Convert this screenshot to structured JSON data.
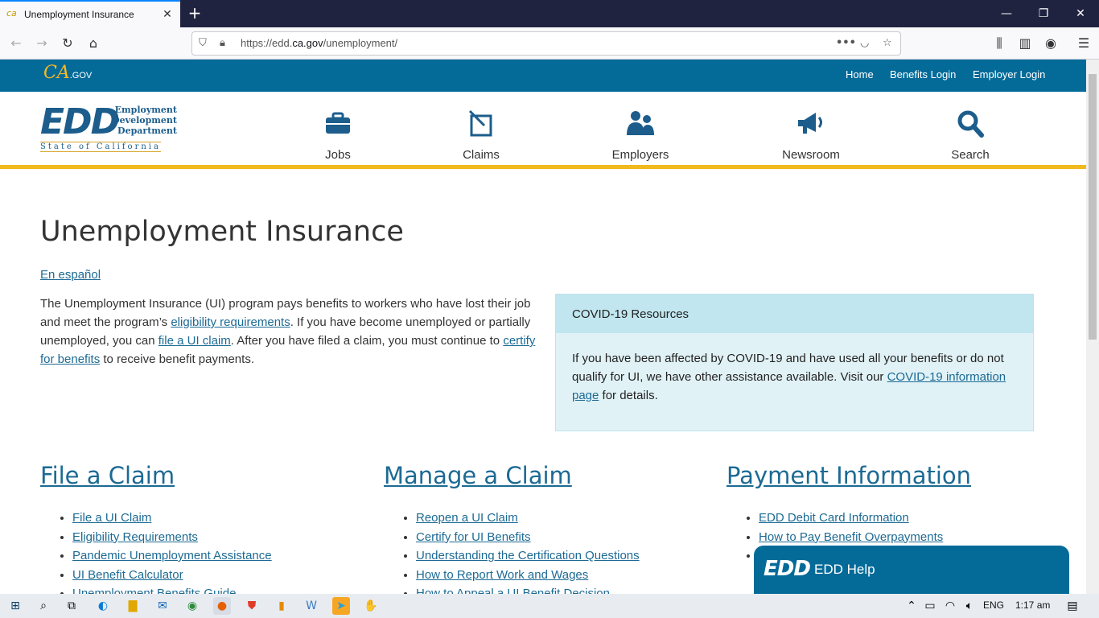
{
  "browser": {
    "tab_title": "Unemployment Insurance",
    "tab_close": "✕",
    "new_tab": "+",
    "url_prefix": "https://edd.",
    "url_domain": "ca.gov",
    "url_path": "/unemployment/",
    "min": "—",
    "restore": "❐",
    "close": "✕"
  },
  "ca_bar": {
    "logo_ca": "CA",
    "logo_gov": ".GOV",
    "links": [
      "Home",
      "Benefits Login",
      "Employer Login"
    ]
  },
  "edd_logo": {
    "mark": "EDD",
    "dept_line1": "Employment",
    "dept_line2": "Development",
    "dept_line3": "Department",
    "state": "State of California"
  },
  "main_nav": [
    "Jobs",
    "Claims",
    "Employers",
    "Newsroom",
    "Search"
  ],
  "page_title": "Unemployment Insurance",
  "espanol": "En español",
  "intro": {
    "t1": "The Unemployment Insurance (UI) program pays benefits to workers who have lost their job and meet the program’s ",
    "link1": "eligibility requirements",
    "t2": ". If you have become unemployed or partially unemployed, you can ",
    "link2": "file a UI claim",
    "t3": ". After you have filed a claim, you must continue to ",
    "link3": "certify for benefits",
    "t4": " to receive benefit payments."
  },
  "covid": {
    "heading": "COVID-19 Resources",
    "t1": "If you have been affected by COVID-19 and have used all your benefits or do not qualify for UI, we have other assistance available. Visit our ",
    "link": "COVID-19 information page",
    "t2": " for details."
  },
  "columns": [
    {
      "heading": "File a Claim",
      "items": [
        "File a UI Claim",
        "Eligibility Requirements",
        "Pandemic Unemployment Assistance",
        "UI Benefit Calculator",
        "Unemployment Benefits Guide"
      ]
    },
    {
      "heading": "Manage a Claim",
      "items": [
        "Reopen a UI Claim",
        "Certify for UI Benefits",
        "Understanding the Certification Questions",
        "How to Report Work and Wages",
        "How to Appeal a UI Benefit Decision"
      ]
    },
    {
      "heading": "Payment Information",
      "items": [
        "EDD Debit Card Information",
        "How to Pay Benefit Overpayments",
        ""
      ]
    }
  ],
  "help": {
    "logo": "EDD",
    "label": "EDD Help"
  },
  "taskbar": {
    "lang": "ENG",
    "time": "1:17 am"
  }
}
